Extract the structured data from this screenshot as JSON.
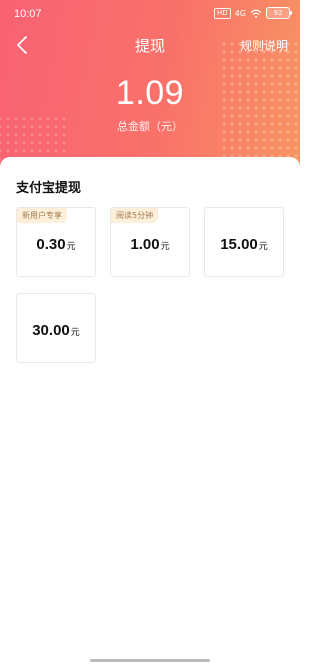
{
  "status_bar": {
    "time": "10:07",
    "indicators": [
      "HD",
      "4G"
    ],
    "battery": "92"
  },
  "nav": {
    "back_icon": "chevron-left-icon",
    "title": "提现",
    "rules_link": "规则说明"
  },
  "balance": {
    "amount": "1.09",
    "label": "总金额（元）"
  },
  "withdraw": {
    "section_title": "支付宝提现",
    "options": [
      {
        "badge": "新用户专享",
        "amount": "0.30",
        "unit": "元"
      },
      {
        "badge": "阅读5分钟",
        "amount": "1.00",
        "unit": "元"
      },
      {
        "badge": "",
        "amount": "15.00",
        "unit": "元"
      },
      {
        "badge": "",
        "amount": "30.00",
        "unit": "元"
      }
    ]
  },
  "colors": {
    "header_start": "#f86273",
    "header_end": "#f89562",
    "badge_bg": "#fdefd9",
    "badge_text": "#a07c4f"
  }
}
